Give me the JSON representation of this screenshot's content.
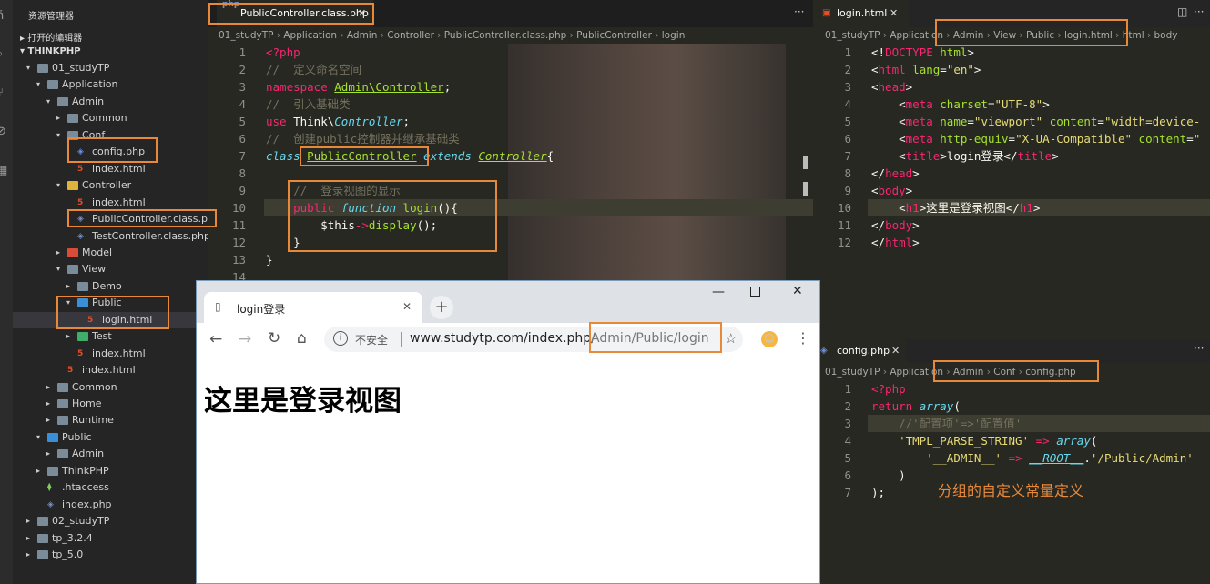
{
  "sidebar": {
    "title": "资源管理器",
    "open_editors": "打开的编辑器",
    "root": "THINKPHP",
    "tree": [
      {
        "label": "01_studyTP",
        "depth": 1,
        "arrow": "▾",
        "icon": "folder"
      },
      {
        "label": "Application",
        "depth": 2,
        "arrow": "▾",
        "icon": "folder"
      },
      {
        "label": "Admin",
        "depth": 3,
        "arrow": "▾",
        "icon": "folder"
      },
      {
        "label": "Common",
        "depth": 4,
        "arrow": "▸",
        "icon": "folder"
      },
      {
        "label": "Conf",
        "depth": 4,
        "arrow": "▾",
        "icon": "folder"
      },
      {
        "label": "config.php",
        "depth": 5,
        "arrow": "",
        "icon": "php-file-icon"
      },
      {
        "label": "index.html",
        "depth": 5,
        "arrow": "",
        "icon": "html-file-icon"
      },
      {
        "label": "Controller",
        "depth": 4,
        "arrow": "▾",
        "icon": "folder-yellow"
      },
      {
        "label": "index.html",
        "depth": 5,
        "arrow": "",
        "icon": "html-file-icon"
      },
      {
        "label": "PublicController.class.php",
        "depth": 5,
        "arrow": "",
        "icon": "php-file-icon"
      },
      {
        "label": "TestController.class.php",
        "depth": 5,
        "arrow": "",
        "icon": "php-file-icon"
      },
      {
        "label": "Model",
        "depth": 4,
        "arrow": "▸",
        "icon": "folder-red"
      },
      {
        "label": "View",
        "depth": 4,
        "arrow": "▾",
        "icon": "folder"
      },
      {
        "label": "Demo",
        "depth": 5,
        "arrow": "▸",
        "icon": "folder"
      },
      {
        "label": "Public",
        "depth": 5,
        "arrow": "▾",
        "icon": "folder-blue"
      },
      {
        "label": "login.html",
        "depth": 6,
        "arrow": "",
        "icon": "html-file-icon"
      },
      {
        "label": "Test",
        "depth": 5,
        "arrow": "▸",
        "icon": "folder-green"
      },
      {
        "label": "index.html",
        "depth": 5,
        "arrow": "",
        "icon": "html-file-icon"
      },
      {
        "label": "index.html",
        "depth": 4,
        "arrow": "",
        "icon": "html-file-icon"
      },
      {
        "label": "Common",
        "depth": 3,
        "arrow": "▸",
        "icon": "folder"
      },
      {
        "label": "Home",
        "depth": 3,
        "arrow": "▸",
        "icon": "folder"
      },
      {
        "label": "Runtime",
        "depth": 3,
        "arrow": "▸",
        "icon": "folder"
      },
      {
        "label": "Public",
        "depth": 2,
        "arrow": "▾",
        "icon": "folder-blue"
      },
      {
        "label": "Admin",
        "depth": 3,
        "arrow": "▸",
        "icon": "folder"
      },
      {
        "label": "ThinkPHP",
        "depth": 2,
        "arrow": "▸",
        "icon": "folder"
      },
      {
        "label": ".htaccess",
        "depth": 2,
        "arrow": "",
        "icon": "apache-file-icon"
      },
      {
        "label": "index.php",
        "depth": 2,
        "arrow": "",
        "icon": "php-file-icon"
      },
      {
        "label": "02_studyTP",
        "depth": 1,
        "arrow": "▸",
        "icon": "folder"
      },
      {
        "label": "tp_3.2.4",
        "depth": 1,
        "arrow": "▸",
        "icon": "folder"
      },
      {
        "label": "tp_5.0",
        "depth": 1,
        "arrow": "▸",
        "icon": "folder"
      }
    ]
  },
  "editor1": {
    "tab": "PublicController.class.php",
    "breadcrumb": [
      "01_studyTP",
      "Application",
      "Admin",
      "Controller",
      "PublicController.class.php",
      "PublicController",
      "login"
    ],
    "line_numbers": [
      "1",
      "2",
      "3",
      "4",
      "5",
      "6",
      "7",
      "8",
      "9",
      "10",
      "11",
      "12",
      "13",
      "14"
    ],
    "more": "···"
  },
  "editor2": {
    "tab": "login.html",
    "breadcrumb": [
      "01_studyTP",
      "Application",
      "Admin",
      "View",
      "Public",
      "login.html",
      "html",
      "body"
    ],
    "line_numbers": [
      "1",
      "2",
      "3",
      "4",
      "5",
      "6",
      "7",
      "8",
      "9",
      "10",
      "11",
      "12"
    ],
    "more": "···"
  },
  "editor3": {
    "tab": "config.php",
    "breadcrumb": [
      "01_studyTP",
      "Application",
      "Admin",
      "Conf",
      "config.php"
    ],
    "line_numbers": [
      "1",
      "2",
      "3",
      "4",
      "5",
      "6",
      "7"
    ],
    "more": "···",
    "annotation": "分组的自定义常量定义"
  },
  "browser": {
    "tab_title": "login登录",
    "security": "不安全",
    "url_host": "www.studytp.com/index.php/",
    "url_path": "Admin/Public/login",
    "page_heading": "这里是登录视图"
  },
  "colors": {
    "accent": "#e8893a",
    "bg": "#272822"
  }
}
